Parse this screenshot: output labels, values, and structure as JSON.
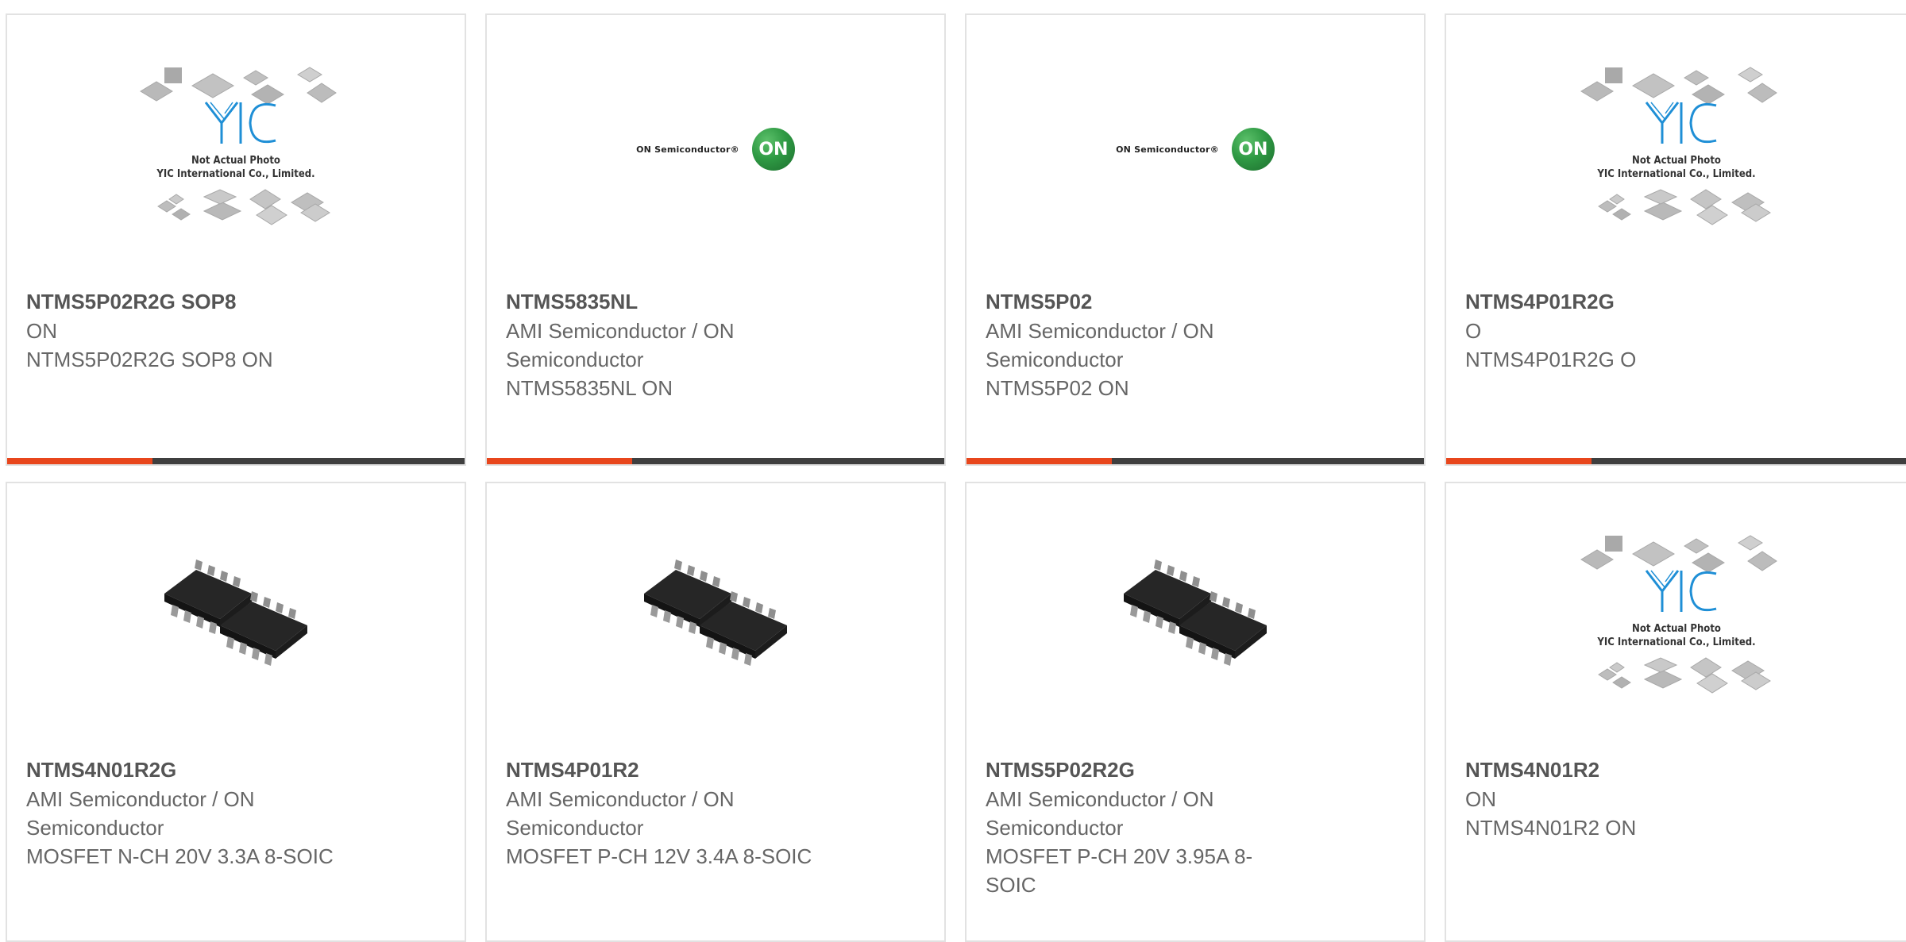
{
  "products": [
    {
      "part": "NTMS5P02R2G SOP8",
      "manufacturer": "ON",
      "description": "NTMS5P02R2G SOP8 ON",
      "image": "yic-placeholder"
    },
    {
      "part": "NTMS5835NL",
      "manufacturer": "AMI Semiconductor / ON Semiconductor",
      "description": "NTMS5835NL ON",
      "image": "on-semi-logo"
    },
    {
      "part": "NTMS5P02",
      "manufacturer": "AMI Semiconductor / ON Semiconductor",
      "description": "NTMS5P02 ON",
      "image": "on-semi-logo"
    },
    {
      "part": "NTMS4P01R2G",
      "manufacturer": "O",
      "description": "NTMS4P01R2G O",
      "image": "yic-placeholder"
    },
    {
      "part": "NTMS4N01R2G",
      "manufacturer": "AMI Semiconductor / ON Semiconductor",
      "description": "MOSFET N-CH 20V 3.3A 8-SOIC",
      "image": "soic8-photo"
    },
    {
      "part": "NTMS4P01R2",
      "manufacturer": "AMI Semiconductor / ON Semiconductor",
      "description": "MOSFET P-CH 12V 3.4A 8-SOIC",
      "image": "soic8-photo"
    },
    {
      "part": "NTMS5P02R2G",
      "manufacturer": "AMI Semiconductor / ON Semiconductor",
      "description": "MOSFET P-CH 20V 3.95A 8-SOIC",
      "image": "soic8-photo"
    },
    {
      "part": "NTMS4N01R2",
      "manufacturer": "ON",
      "description": "NTMS4N01R2 ON",
      "image": "yic-placeholder"
    }
  ],
  "placeholder": {
    "line1": "Not Actual Photo",
    "line2": "YIC International Co., Limited.",
    "logo_text": "YIC"
  },
  "on_logo": {
    "wordmark": "ON Semiconductor®",
    "badge": "ON"
  },
  "colors": {
    "accent": "#e8461c",
    "bar": "#3f3f3f",
    "border": "#e2e2e2",
    "yic_blue": "#1f8fd6"
  }
}
